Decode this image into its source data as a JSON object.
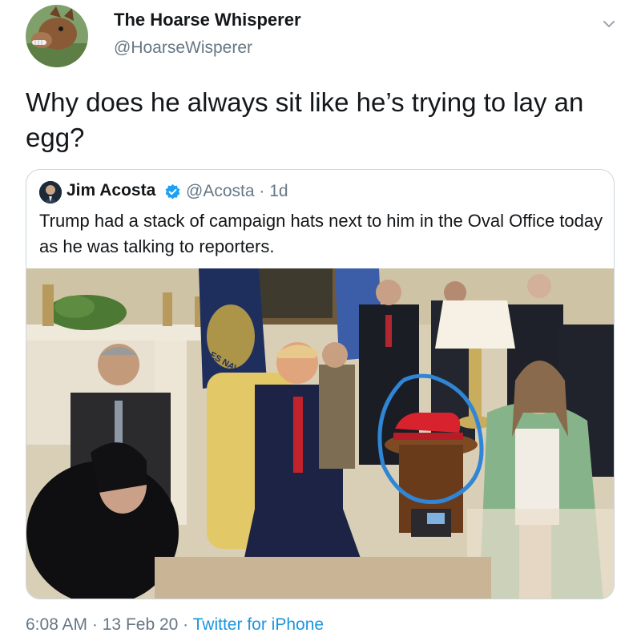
{
  "tweet": {
    "author_name": "The Hoarse Whisperer",
    "author_handle": "@HoarseWisperer",
    "avatar_icon": "horse-avatar-icon",
    "more_icon": "chevron-down-icon",
    "text": "Why does he always sit like he’s trying to lay an egg?",
    "time": "6:08 AM",
    "separator": "·",
    "date": "13 Feb 20",
    "source": "Twitter for iPhone"
  },
  "quoted": {
    "author_name": "Jim Acosta",
    "verified_icon": "verified-badge-icon",
    "author_handle": "@Acosta",
    "age": "· 1d",
    "text": "Trump had a stack of campaign hats next to him in the Oval Office today as he was talking to reporters.",
    "photo": {
      "flag_text": "ES NAVY",
      "highlight_color": "#2f86d6"
    }
  },
  "colors": {
    "text_primary": "#14171a",
    "text_secondary": "#657786",
    "link": "#1b95e0",
    "border": "#ccd6dd"
  }
}
